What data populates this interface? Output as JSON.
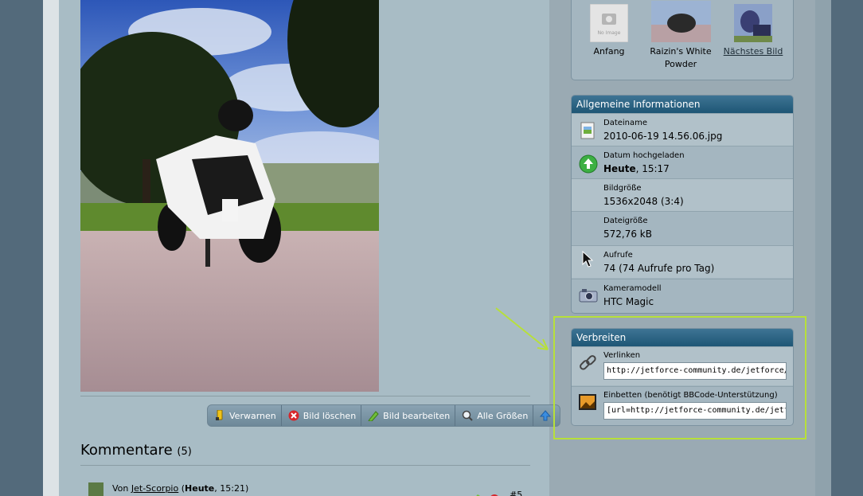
{
  "nav": {
    "items": [
      {
        "label": "Anfang",
        "thumb_alt": "No Image"
      },
      {
        "label": "Raizin's White Powder"
      },
      {
        "label": "Nächstes Bild"
      }
    ]
  },
  "toolbar": {
    "warn": "Verwarnen",
    "delete": "Bild löschen",
    "edit": "Bild bearbeiten",
    "sizes": "Alle Größen"
  },
  "comments": {
    "title": "Kommentare",
    "count": "(5)",
    "first": {
      "prefix": "Von",
      "user": "Jet-Scorpio",
      "open": "(",
      "time_bold": "Heute",
      "time_rest": ", 15:21)",
      "number": "#5"
    }
  },
  "info": {
    "title": "Allgemeine Informationen",
    "rows": [
      {
        "label": "Dateiname",
        "value": "2010-06-19 14.56.06.jpg",
        "icon": "image-file-icon"
      },
      {
        "label": "Datum hochgeladen",
        "value_bold": "Heute",
        "value": ", 15:17",
        "icon": "upload-arrow-icon"
      },
      {
        "label": "Bildgröße",
        "value": "1536x2048 (3:4)"
      },
      {
        "label": "Dateigröße",
        "value": "572,76 kB"
      },
      {
        "label": "Aufrufe",
        "value": "74 (74 Aufrufe pro Tag)"
      },
      {
        "label": "Kameramodell",
        "value": "HTC Magic",
        "icon": "camera-icon"
      }
    ]
  },
  "share": {
    "title": "Verbreiten",
    "link_label": "Verlinken",
    "link_value": "http://jetforce-community.de/jetforce/index.php?page=UserGalleryPhoto",
    "embed_label": "Einbetten (benötigt BBCode-Unterstützung)",
    "embed_value": "[url=http://jetforce-community.de/jetforce/index.php?page=UserGalleryPhoto"
  },
  "colors": {
    "header_blue": "#1e5675",
    "highlight": "#b7e03a"
  }
}
